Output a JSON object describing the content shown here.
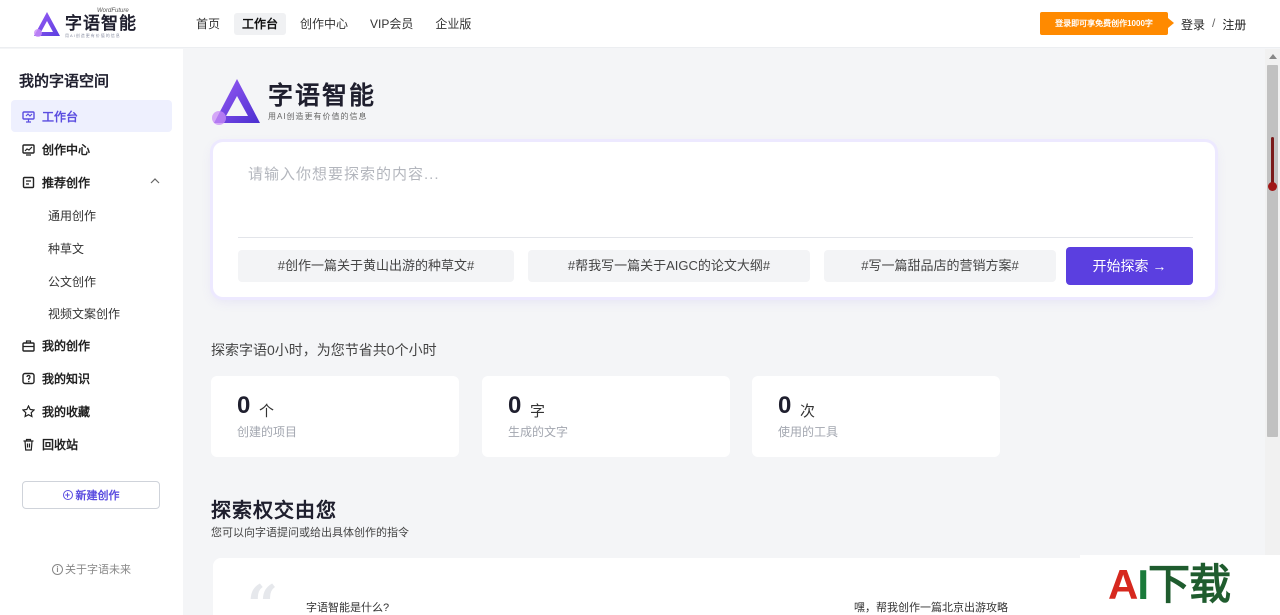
{
  "brand": {
    "tagline_small": "WordFuture",
    "name": "字语智能",
    "hero_subtitle": "用AI创造更有价值的信息"
  },
  "nav": {
    "items": [
      {
        "label": "首页",
        "active": false
      },
      {
        "label": "工作台",
        "active": true
      },
      {
        "label": "创作中心",
        "active": false
      },
      {
        "label": "VIP会员",
        "active": false
      },
      {
        "label": "企业版",
        "active": false
      }
    ],
    "promo": "登录即可享免费创作1000字",
    "login": "登录",
    "separator": "/",
    "register": "注册"
  },
  "sidebar": {
    "title": "我的字语空间",
    "items": [
      {
        "label": "工作台",
        "icon": "monitor-icon"
      },
      {
        "label": "创作中心",
        "icon": "chart-icon"
      },
      {
        "label": "推荐创作",
        "icon": "doc-icon"
      }
    ],
    "sub_items": [
      "通用创作",
      "种草文",
      "公文创作",
      "视频文案创作"
    ],
    "more_items": [
      {
        "label": "我的创作",
        "icon": "briefcase-icon"
      },
      {
        "label": "我的知识",
        "icon": "question-icon"
      },
      {
        "label": "我的收藏",
        "icon": "star-icon"
      },
      {
        "label": "回收站",
        "icon": "trash-icon"
      }
    ],
    "new_button": "新建创作",
    "about": "关于字语未来"
  },
  "search": {
    "placeholder": "请输入你想要探索的内容...",
    "chips": [
      "#创作一篇关于黄山出游的种草文#",
      "#帮我写一篇关于AIGC的论文大纲#",
      "#写一篇甜品店的营销方案#"
    ],
    "start_button": "开始探索 →"
  },
  "stats": {
    "summary": "探索字语0小时，为您节省共0个小时",
    "cards": [
      {
        "value": "0",
        "unit": "个",
        "label": "创建的项目"
      },
      {
        "value": "0",
        "unit": "字",
        "label": "生成的文字"
      },
      {
        "value": "0",
        "unit": "次",
        "label": "使用的工具"
      }
    ]
  },
  "explore": {
    "title": "探索权交由您",
    "subtitle": "您可以向字语提问或给出具体创作的指令",
    "quote_mark": "“",
    "question_1": "字语智能是什么?",
    "question_2": "嘿，帮我创作一篇北京出游攻略"
  },
  "watermark": {
    "a": "A",
    "i": "I",
    "rest": "下载"
  },
  "colors": {
    "accent": "#5b3fe0",
    "promo": "#ff8a00",
    "active_bg": "#eef0fe"
  }
}
